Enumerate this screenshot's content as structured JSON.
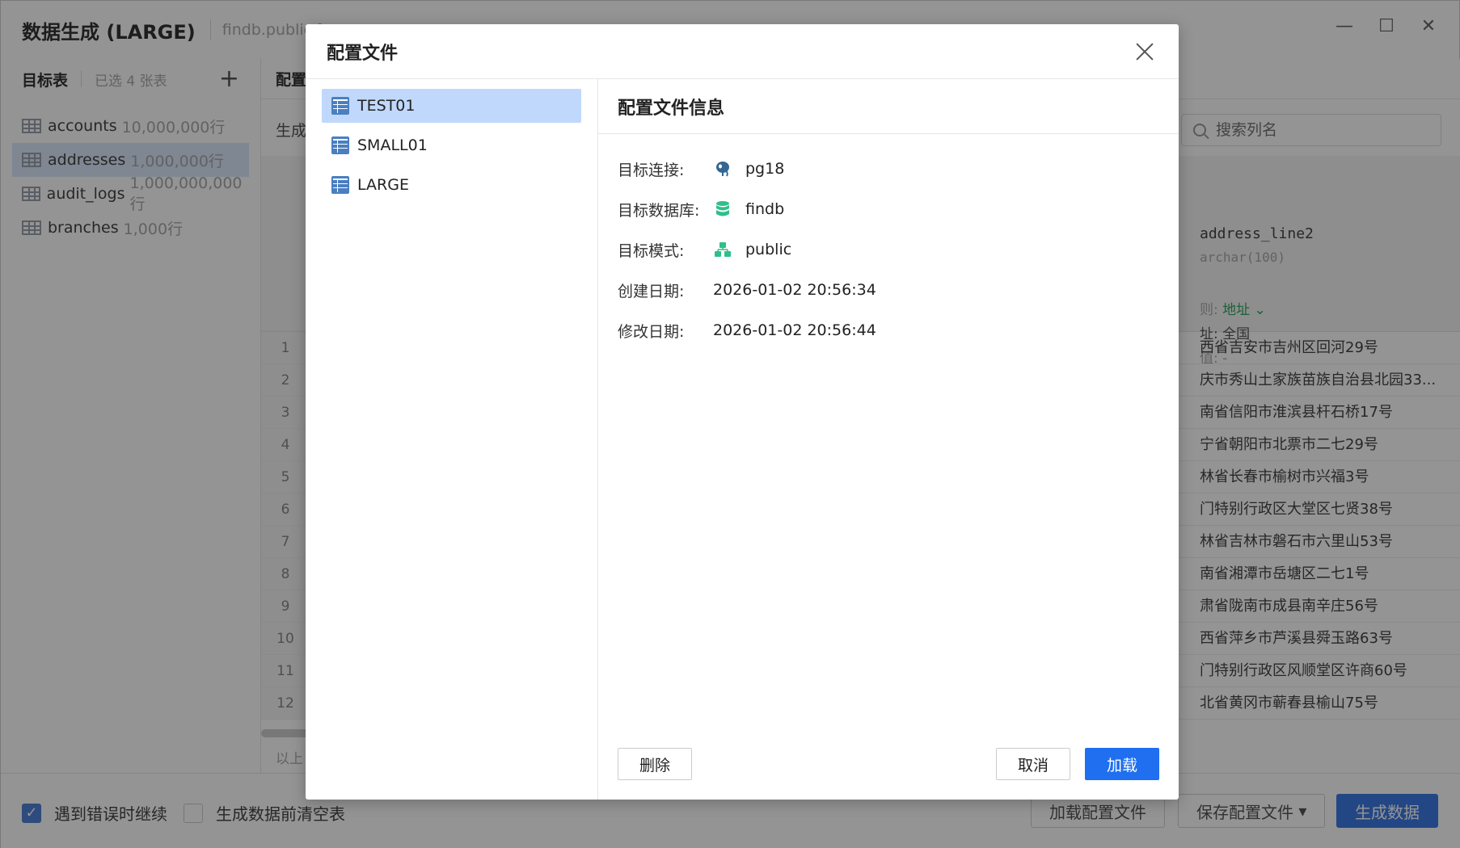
{
  "window": {
    "title": "数据生成 (LARGE)",
    "path": "findb.public [p"
  },
  "left_pane": {
    "title": "目标表",
    "selected_count": "已选 4 张表",
    "add_icon": "plus-icon",
    "tables": [
      {
        "name": "accounts",
        "rows": "10,000,000行"
      },
      {
        "name": "addresses",
        "rows": "1,000,000行"
      },
      {
        "name": "audit_logs",
        "rows": "1,000,000,000行"
      },
      {
        "name": "branches",
        "rows": "1,000行"
      }
    ]
  },
  "main": {
    "tab_partial": "配置",
    "gen_partial": "生成",
    "search_placeholder": "搜索列名",
    "column": {
      "name": "address_line2",
      "type": "archar(100)",
      "rule_label": "则:",
      "rule_value": "地址",
      "range": "址:  全国",
      "null": "值:  -"
    },
    "row_numbers": [
      "1",
      "2",
      "3",
      "4",
      "5",
      "6",
      "7",
      "8",
      "9",
      "10",
      "11",
      "12"
    ],
    "cells": [
      "西省吉安市吉州区回河29号",
      "庆市秀山土家族苗族自治县北园33...",
      "南省信阳市淮滨县杆石桥17号",
      "宁省朝阳市北票市二七29号",
      "林省长春市榆树市兴福3号",
      "门特别行政区大堂区七贤38号",
      "林省吉林市磐石市六里山53号",
      "南省湘潭市岳塘区二七1号",
      "肃省陇南市成县南辛庄56号",
      "西省萍乡市芦溪县舜玉路63号",
      "门特别行政区风顺堂区许商60号",
      "北省黄冈市蕲春县榆山75号"
    ],
    "footer_partial": "以上"
  },
  "bottom_bar": {
    "continue_on_error": "遇到错误时继续",
    "continue_checked": true,
    "truncate_before": "生成数据前清空表",
    "truncate_checked": false,
    "load_profile": "加载配置文件",
    "save_profile": "保存配置文件",
    "generate": "生成数据"
  },
  "dialog": {
    "title": "配置文件",
    "profiles": [
      "TEST01",
      "SMALL01",
      "LARGE"
    ],
    "selected_profile": "TEST01",
    "info_title": "配置文件信息",
    "info": [
      {
        "label": "目标连接:",
        "icon": "postgres-icon",
        "value": "pg18"
      },
      {
        "label": "目标数据库:",
        "icon": "database-icon",
        "value": "findb"
      },
      {
        "label": "目标模式:",
        "icon": "schema-icon",
        "value": "public"
      },
      {
        "label": "创建日期:",
        "icon": "",
        "value": "2026-01-02 20:56:34"
      },
      {
        "label": "修改日期:",
        "icon": "",
        "value": "2026-01-02 20:56:44"
      }
    ],
    "delete_label": "删除",
    "cancel_label": "取消",
    "load_label": "加载"
  },
  "colors": {
    "accent": "#1f6ff0",
    "selected_profile_bg": "#c0d8fb",
    "selected_table_bg": "#dbe8fc",
    "db_green": "#2fbf8a"
  }
}
